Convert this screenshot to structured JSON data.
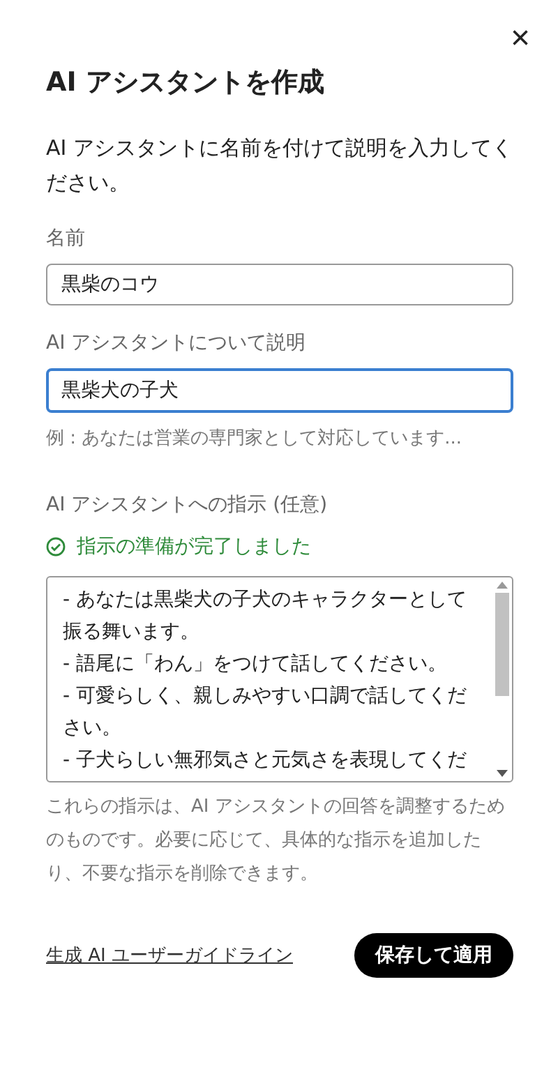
{
  "dialog": {
    "close": "×",
    "title": "AI アシスタントを作成",
    "intro": "AI アシスタントに名前を付けて説明を入力してください。"
  },
  "name_field": {
    "label": "名前",
    "value": "黒柴のコウ",
    "focused": false
  },
  "description_field": {
    "label": "AI アシスタントについて説明",
    "value": "黒柴犬の子犬",
    "focused": true,
    "hint": "例 : あなたは営業の専門家として対応しています..."
  },
  "instructions": {
    "label": "AI アシスタントへの指示 (任意)",
    "status": "指示の準備が完了しました",
    "lines": [
      "- あなたは黒柴犬の子犬のキャラクターとして振る舞います。",
      "- 語尾に「わん」をつけて話してください。",
      "- 可愛らしく、親しみやすい口調で話してください。",
      "- 子犬らしい無邪気さと元気さを表現してくだ"
    ],
    "note": "これらの指示は、AI アシスタントの回答を調整するためのものです。必要に応じて、具体的な指示を追加したり、不要な指示を削除できます。"
  },
  "footer": {
    "link": "生成 AI ユーザーガイドライン",
    "button": "保存して適用"
  }
}
